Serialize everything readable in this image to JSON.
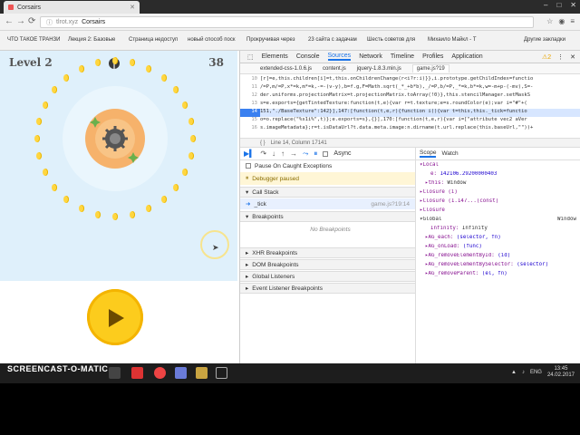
{
  "browser": {
    "tab_title": "Corsairs",
    "url_host": "tlrot.xyz",
    "url_path": "Corsairs",
    "bookmarks": [
      "ЧТО ТАКОЕ ТРАНЗИ",
      "Лекция 2: Базовые",
      "Страница недоступ",
      "новый способ поск",
      "Прокручивая через",
      "23 сайта с задачам",
      "Шесть советов для",
      "Михаило Майкл - Т",
      "Другие закладки"
    ]
  },
  "game": {
    "level_label": "Level 2",
    "score": "38",
    "colors": {
      "sky": "#dff0fb",
      "coin": "#ffd640",
      "sun": "#f6b26b",
      "play": "#fccc1d"
    }
  },
  "devtools": {
    "tabs": [
      "Elements",
      "Console",
      "Sources",
      "Network",
      "Timeline",
      "Profiles",
      "Application"
    ],
    "active_tab": "Sources",
    "warnings": "2",
    "files": [
      "extended-css-1.0.6.js",
      "content.js",
      "jquery-1.8.3.min.js",
      "game.js?19"
    ],
    "code_lines": [
      {
        "n": "10",
        "text": "[r]=e,this.children[i]=t,this.onChildrenChange(r<i?r:i)}},i.prototype.getChildIndex=functio"
      },
      {
        "n": "11",
        "text": "/=P,m/=P,x*=k,m*=k,-=-(v-y),b=f.g,F=Math.sqrt(_*_+b*b),_/=P,b/=P,_*=k,b*=k,w=-m+p-(-mv),S=-"
      },
      {
        "n": "12",
        "text": "der.uniforms.projectionMatrix=t.projectionMatrix.toArray(!0)},this.stencilManager.setMaskS"
      },
      {
        "n": "13",
        "text": "s=e.exports={getTintedTexture:function(t,e){var r=t.texture;e=s.roundColor(e);var i=\"#\"+("
      },
      {
        "n": "14",
        "text": "151,\"./BaseTexture\":142}],147:[function(t,e,r){function i(){var t=this,this._tick=functio"
      },
      {
        "n": "15",
        "text": "o=o.replace(\"%s1i%\",t)};e.exports=s},{}],170:[function(t,e,r){var i=[\"attribute vec2 aVer"
      },
      {
        "n": "16",
        "text": "s.imageMetadata};r=t.isDataUrl?t.data.meta.image:n.dirname(t.url.replace(this.baseUrl,\"\"))+"
      }
    ],
    "status_line": "Line 14, Column 17141",
    "async_label": "Async",
    "pause_exceptions": "Pause On Caught Exceptions",
    "debugger_paused": "Debugger paused",
    "call_stack": "Call Stack",
    "frame_name": "_tick",
    "frame_location": "game.js?19:14",
    "breakpoints": "Breakpoints",
    "no_breakpoints": "No Breakpoints",
    "sections": [
      "XHR Breakpoints",
      "DOM Breakpoints",
      "Global Listeners",
      "Event Listener Breakpoints"
    ],
    "scope_tabs": [
      "Scope",
      "Watch"
    ],
    "scope": [
      {
        "indent": 0,
        "key": "▾Local",
        "val": ""
      },
      {
        "indent": 2,
        "key": "e:",
        "val": "142106.29200000403"
      },
      {
        "indent": 1,
        "key": "▸this:",
        "val": "Window"
      },
      {
        "indent": 0,
        "key": "▸Closure (i)",
        "val": ""
      },
      {
        "indent": 0,
        "key": "▸Closure (1.147...(const)",
        "val": ""
      },
      {
        "indent": 0,
        "key": "▸Closure",
        "val": ""
      },
      {
        "indent": 0,
        "key": "▾Global",
        "val": "Window"
      },
      {
        "indent": 2,
        "key": "Infinity:",
        "val": "Infinity"
      },
      {
        "indent": 1,
        "key": "▸AG_each:",
        "val": "(selector, fn)"
      },
      {
        "indent": 1,
        "key": "▸AG_onLoad:",
        "val": "(func)"
      },
      {
        "indent": 1,
        "key": "▸AG_removeElementById:",
        "val": "(id)"
      },
      {
        "indent": 1,
        "key": "▸AG_removeElementBySelector:",
        "val": "(selector)"
      },
      {
        "indent": 1,
        "key": "▸AG_removeParent:",
        "val": "(el, fn)"
      }
    ]
  },
  "taskbar": {
    "lang": "ENG",
    "time": "13:45",
    "date": "24.02.2017"
  },
  "watermark": {
    "recorded": "RECORDED WITH",
    "brand": "SCREENCAST-O-MATIC"
  }
}
